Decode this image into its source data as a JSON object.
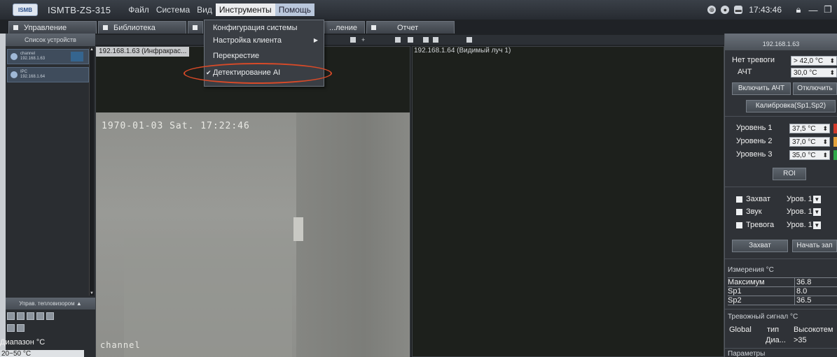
{
  "app": {
    "logo_text": "ISMB",
    "title": "ISMTB-ZS-315",
    "time": "17:43:46"
  },
  "menu": {
    "items": [
      "Файл",
      "Система",
      "Вид",
      "Инструменты",
      "Помощь"
    ]
  },
  "tabs": [
    "Управление",
    "Библиотека",
    "",
    "...ление",
    "Отчет"
  ],
  "tools_menu": {
    "items": [
      "Конфигурация системы",
      "Настройка клиента",
      "Перекрестие",
      "Детектирование AI"
    ],
    "checked": "Детектирование AI"
  },
  "left_panel": {
    "title": "Список устройств",
    "devices": [
      {
        "name": "channel",
        "ip": "192.168.1.63"
      },
      {
        "name": "IPC",
        "ip": "192.168.1.64"
      }
    ],
    "thermal_title": "Управ. тепловизором ▲",
    "range_label": "Диапазон °С",
    "range_value": "20~50 °C"
  },
  "video": {
    "pane1_label": "192.168.1.63 (Инфракрас...",
    "pane2_label": "192.168.1.64 (Видимый луч 1)",
    "osd_time": "1970-01-03 Sat. 17:22:46",
    "osd_channel": "channel"
  },
  "right_panel": {
    "ip": "192.168.1.63",
    "no_alarm_label": "Нет тревоги",
    "no_alarm_value": "> 42,0 °C",
    "ach_label": "АЧТ",
    "ach_value": "30,0 °C",
    "enable_ach": "Включить АЧТ",
    "disable_ach": "Отключить",
    "calibration": "Калибровка(Sp1,Sp2)",
    "levels": [
      {
        "label": "Уровень 1",
        "value": "37,5 °C",
        "color": "#d23a2a"
      },
      {
        "label": "Уровень 2",
        "value": "37,0 °C",
        "color": "#e3a13a"
      },
      {
        "label": "Уровень 3",
        "value": "35,0 °C",
        "color": "#2fa84a"
      }
    ],
    "roi": "ROI",
    "options": [
      {
        "label": "Захват",
        "level": "Уров. 1"
      },
      {
        "label": "Звук",
        "level": "Уров. 1"
      },
      {
        "label": "Тревога",
        "level": "Уров. 1"
      }
    ],
    "capture_btn": "Захват",
    "start_btn": "Начать зап",
    "measurements_title": "Измерения °С",
    "measurements": [
      {
        "name": "Максимум",
        "value": "36.8"
      },
      {
        "name": "Sp1",
        "value": "8.0"
      },
      {
        "name": "Sp2",
        "value": "36.5"
      }
    ],
    "alarm_title": "Тревожный сигнал °С",
    "alarm_global": "Global",
    "alarm_type_label": "тип",
    "alarm_type_value": "Высокотем",
    "alarm_range_label": "Диа...",
    "alarm_range_value": ">35",
    "params_title": "Параметры"
  }
}
